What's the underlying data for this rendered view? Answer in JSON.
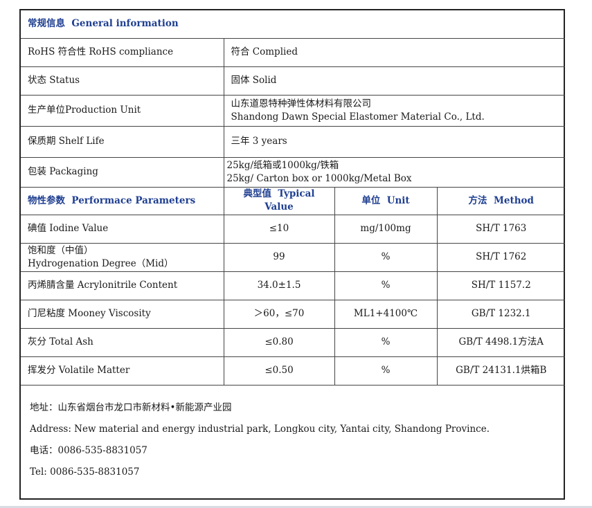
{
  "general": {
    "header_cn": "常规信息",
    "header_en": "General information",
    "rows": [
      {
        "label": "RoHS 符合性  RoHS compliance",
        "value": [
          "符合  Complied"
        ]
      },
      {
        "label": "状态  Status",
        "value": [
          "固体 Solid"
        ]
      },
      {
        "label": "生产单位Production Unit",
        "value": [
          "山东道恩特种弹性体材料有限公司",
          "Shandong Dawn Special Elastomer Material Co., Ltd."
        ]
      },
      {
        "label": "保质期  Shelf Life",
        "value": [
          "三年 3 years"
        ]
      },
      {
        "label": "包装 Packaging",
        "value": [
          "25kg/纸箱或1000kg/铁箱",
          "25kg/ Carton box or 1000kg/Metal Box"
        ]
      }
    ]
  },
  "performance": {
    "headers": {
      "param_cn": "物性参数",
      "param_en": "Performace Parameters",
      "typical_cn": "典型值",
      "typical_en": "Typical Value",
      "unit_cn": "单位",
      "unit_en": "Unit",
      "method_cn": "方法",
      "method_en": "Method"
    },
    "rows": [
      {
        "param": [
          "碘值  Iodine Value"
        ],
        "typical": "≤10",
        "unit": "mg/100mg",
        "method": "SH/T 1763"
      },
      {
        "param": [
          "饱和度（中值）",
          "Hydrogenation Degree（Mid）"
        ],
        "typical": "99",
        "unit": "%",
        "method": "SH/T 1762"
      },
      {
        "param": [
          "丙烯腈含量 Acrylonitrile Content"
        ],
        "typical": "34.0±1.5",
        "unit": "%",
        "method": "SH/T 1157.2"
      },
      {
        "param": [
          "门尼粘度  Mooney Viscosity"
        ],
        "typical": "＞60，≤70",
        "unit": "ML1+4100℃",
        "method": "GB/T 1232.1"
      },
      {
        "param": [
          "灰分  Total Ash"
        ],
        "typical": "≤0.80",
        "unit": "%",
        "method": "GB/T 4498.1方法A"
      },
      {
        "param": [
          "挥发分  Volatile Matter"
        ],
        "typical": "≤0.50",
        "unit": "%",
        "method": "GB/T 24131.1烘箱B"
      }
    ]
  },
  "footer": {
    "address_cn": "地址：山东省烟台市龙口市新材料•新能源产业园",
    "address_en": "Address: New material and energy industrial park, Longkou city, Yantai city, Shandong Province.",
    "phone_cn": "电话：0086-535-8831057",
    "phone_en": "Tel: 0086-535-8831057"
  }
}
